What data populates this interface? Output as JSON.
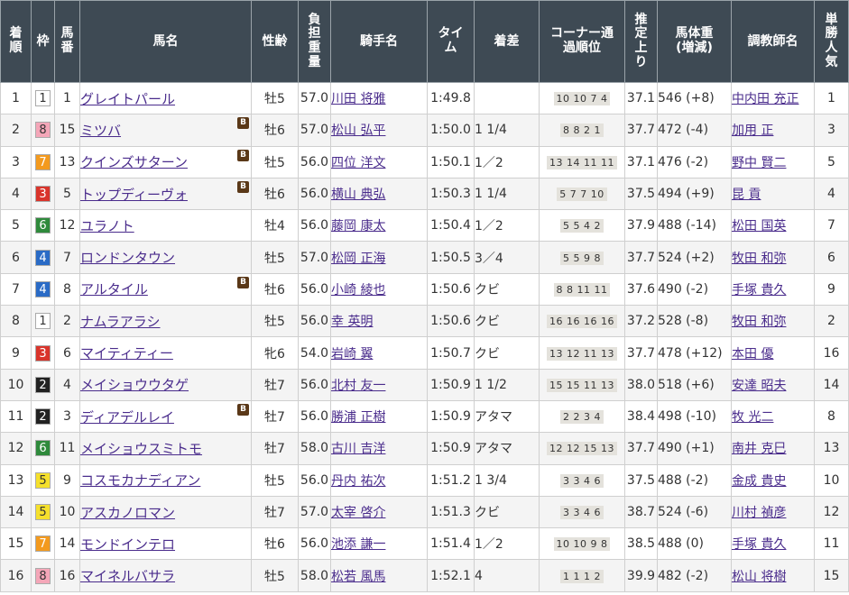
{
  "headers": [
    "着順",
    "枠",
    "馬番",
    "馬名",
    "性齢",
    "負担重量",
    "騎手名",
    "タイム",
    "着差",
    "コーナー通過順位",
    "推定上り",
    "馬体重(増減)",
    "調教師名",
    "単勝人気"
  ],
  "blinker_label": "B",
  "waku_colors": {
    "1": {
      "bg": "#ffffff",
      "fg": "#333333"
    },
    "2": {
      "bg": "#222222",
      "fg": "#ffffff"
    },
    "3": {
      "bg": "#d9342b",
      "fg": "#ffffff"
    },
    "4": {
      "bg": "#2a6bc6",
      "fg": "#ffffff"
    },
    "5": {
      "bg": "#f5e02c",
      "fg": "#333333"
    },
    "6": {
      "bg": "#2f8a3c",
      "fg": "#ffffff"
    },
    "7": {
      "bg": "#f39a1e",
      "fg": "#ffffff"
    },
    "8": {
      "bg": "#f4a6b8",
      "fg": "#333333"
    }
  },
  "rows": [
    {
      "rank": "1",
      "waku": "1",
      "num": "1",
      "horse": "グレイトパール",
      "blinker": false,
      "sexage": "牡5",
      "weight": "57.0",
      "jockey": "川田 将雅",
      "time": "1:49.8",
      "margin": "",
      "corner": "10 10 7 4",
      "last3f": "37.1",
      "bodyweight": "546 (+8)",
      "trainer": "中内田 充正",
      "pop": "1"
    },
    {
      "rank": "2",
      "waku": "8",
      "num": "15",
      "horse": "ミツバ",
      "blinker": true,
      "sexage": "牡6",
      "weight": "57.0",
      "jockey": "松山 弘平",
      "time": "1:50.0",
      "margin": "1 1/4",
      "corner": "8 8 2 1",
      "last3f": "37.7",
      "bodyweight": "472 (-4)",
      "trainer": "加用 正",
      "pop": "3"
    },
    {
      "rank": "3",
      "waku": "7",
      "num": "13",
      "horse": "クインズサターン",
      "blinker": true,
      "sexage": "牡5",
      "weight": "56.0",
      "jockey": "四位 洋文",
      "time": "1:50.1",
      "margin": "1／2",
      "corner": "13 14 11 11",
      "last3f": "37.1",
      "bodyweight": "476 (-2)",
      "trainer": "野中 賢二",
      "pop": "5"
    },
    {
      "rank": "4",
      "waku": "3",
      "num": "5",
      "horse": "トップディーヴォ",
      "blinker": true,
      "sexage": "牡6",
      "weight": "56.0",
      "jockey": "横山 典弘",
      "time": "1:50.3",
      "margin": "1 1/4",
      "corner": "5 7 7 10",
      "last3f": "37.5",
      "bodyweight": "494 (+9)",
      "trainer": "昆 貢",
      "pop": "4"
    },
    {
      "rank": "5",
      "waku": "6",
      "num": "12",
      "horse": "ユラノト",
      "blinker": false,
      "sexage": "牡4",
      "weight": "56.0",
      "jockey": "藤岡 康太",
      "time": "1:50.4",
      "margin": "1／2",
      "corner": "5 5 4 2",
      "last3f": "37.9",
      "bodyweight": "488 (-14)",
      "trainer": "松田 国英",
      "pop": "7"
    },
    {
      "rank": "6",
      "waku": "4",
      "num": "7",
      "horse": "ロンドンタウン",
      "blinker": false,
      "sexage": "牡5",
      "weight": "57.0",
      "jockey": "松岡 正海",
      "time": "1:50.5",
      "margin": "3／4",
      "corner": "5 5 9 8",
      "last3f": "37.7",
      "bodyweight": "524 (+2)",
      "trainer": "牧田 和弥",
      "pop": "6"
    },
    {
      "rank": "7",
      "waku": "4",
      "num": "8",
      "horse": "アルタイル",
      "blinker": true,
      "sexage": "牡6",
      "weight": "56.0",
      "jockey": "小崎 綾也",
      "time": "1:50.6",
      "margin": "クビ",
      "corner": "8 8 11 11",
      "last3f": "37.6",
      "bodyweight": "490 (-2)",
      "trainer": "手塚 貴久",
      "pop": "9"
    },
    {
      "rank": "8",
      "waku": "1",
      "num": "2",
      "horse": "ナムラアラシ",
      "blinker": false,
      "sexage": "牡5",
      "weight": "56.0",
      "jockey": "幸 英明",
      "time": "1:50.6",
      "margin": "クビ",
      "corner": "16 16 16 16",
      "last3f": "37.2",
      "bodyweight": "528 (-8)",
      "trainer": "牧田 和弥",
      "pop": "2"
    },
    {
      "rank": "9",
      "waku": "3",
      "num": "6",
      "horse": "マイティティー",
      "blinker": false,
      "sexage": "牝6",
      "weight": "54.0",
      "jockey": "岩崎 翼",
      "time": "1:50.7",
      "margin": "クビ",
      "corner": "13 12 11 13",
      "last3f": "37.7",
      "bodyweight": "478 (+12)",
      "trainer": "本田 優",
      "pop": "16"
    },
    {
      "rank": "10",
      "waku": "2",
      "num": "4",
      "horse": "メイショウウタゲ",
      "blinker": false,
      "sexage": "牡7",
      "weight": "56.0",
      "jockey": "北村 友一",
      "time": "1:50.9",
      "margin": "1 1/2",
      "corner": "15 15 11 13",
      "last3f": "38.0",
      "bodyweight": "518 (+6)",
      "trainer": "安達 昭夫",
      "pop": "14"
    },
    {
      "rank": "11",
      "waku": "2",
      "num": "3",
      "horse": "ディアデルレイ",
      "blinker": true,
      "sexage": "牡7",
      "weight": "56.0",
      "jockey": "勝浦 正樹",
      "time": "1:50.9",
      "margin": "アタマ",
      "corner": "2 2 3 4",
      "last3f": "38.4",
      "bodyweight": "498 (-10)",
      "trainer": "牧 光二",
      "pop": "8"
    },
    {
      "rank": "12",
      "waku": "6",
      "num": "11",
      "horse": "メイショウスミトモ",
      "blinker": false,
      "sexage": "牡7",
      "weight": "58.0",
      "jockey": "古川 吉洋",
      "time": "1:50.9",
      "margin": "アタマ",
      "corner": "12 12 15 13",
      "last3f": "37.7",
      "bodyweight": "490 (+1)",
      "trainer": "南井 克巳",
      "pop": "13"
    },
    {
      "rank": "13",
      "waku": "5",
      "num": "9",
      "horse": "コスモカナディアン",
      "blinker": false,
      "sexage": "牡5",
      "weight": "56.0",
      "jockey": "丹内 祐次",
      "time": "1:51.2",
      "margin": "1 3/4",
      "corner": "3 3 4 6",
      "last3f": "37.5",
      "bodyweight": "488 (-2)",
      "trainer": "金成 貴史",
      "pop": "10"
    },
    {
      "rank": "14",
      "waku": "5",
      "num": "10",
      "horse": "アスカノロマン",
      "blinker": false,
      "sexage": "牡7",
      "weight": "57.0",
      "jockey": "太宰 啓介",
      "time": "1:51.3",
      "margin": "クビ",
      "corner": "3 3 4 6",
      "last3f": "38.7",
      "bodyweight": "524 (-6)",
      "trainer": "川村 禎彦",
      "pop": "12"
    },
    {
      "rank": "15",
      "waku": "7",
      "num": "14",
      "horse": "モンドインテロ",
      "blinker": false,
      "sexage": "牡6",
      "weight": "56.0",
      "jockey": "池添 謙一",
      "time": "1:51.4",
      "margin": "1／2",
      "corner": "10 10 9 8",
      "last3f": "38.5",
      "bodyweight": "488 (0)",
      "trainer": "手塚 貴久",
      "pop": "11"
    },
    {
      "rank": "16",
      "waku": "8",
      "num": "16",
      "horse": "マイネルバサラ",
      "blinker": false,
      "sexage": "牡5",
      "weight": "58.0",
      "jockey": "松若 風馬",
      "time": "1:52.1",
      "margin": "4",
      "corner": "1 1 1 2",
      "last3f": "39.9",
      "bodyweight": "482 (-2)",
      "trainer": "松山 将樹",
      "pop": "15"
    }
  ]
}
